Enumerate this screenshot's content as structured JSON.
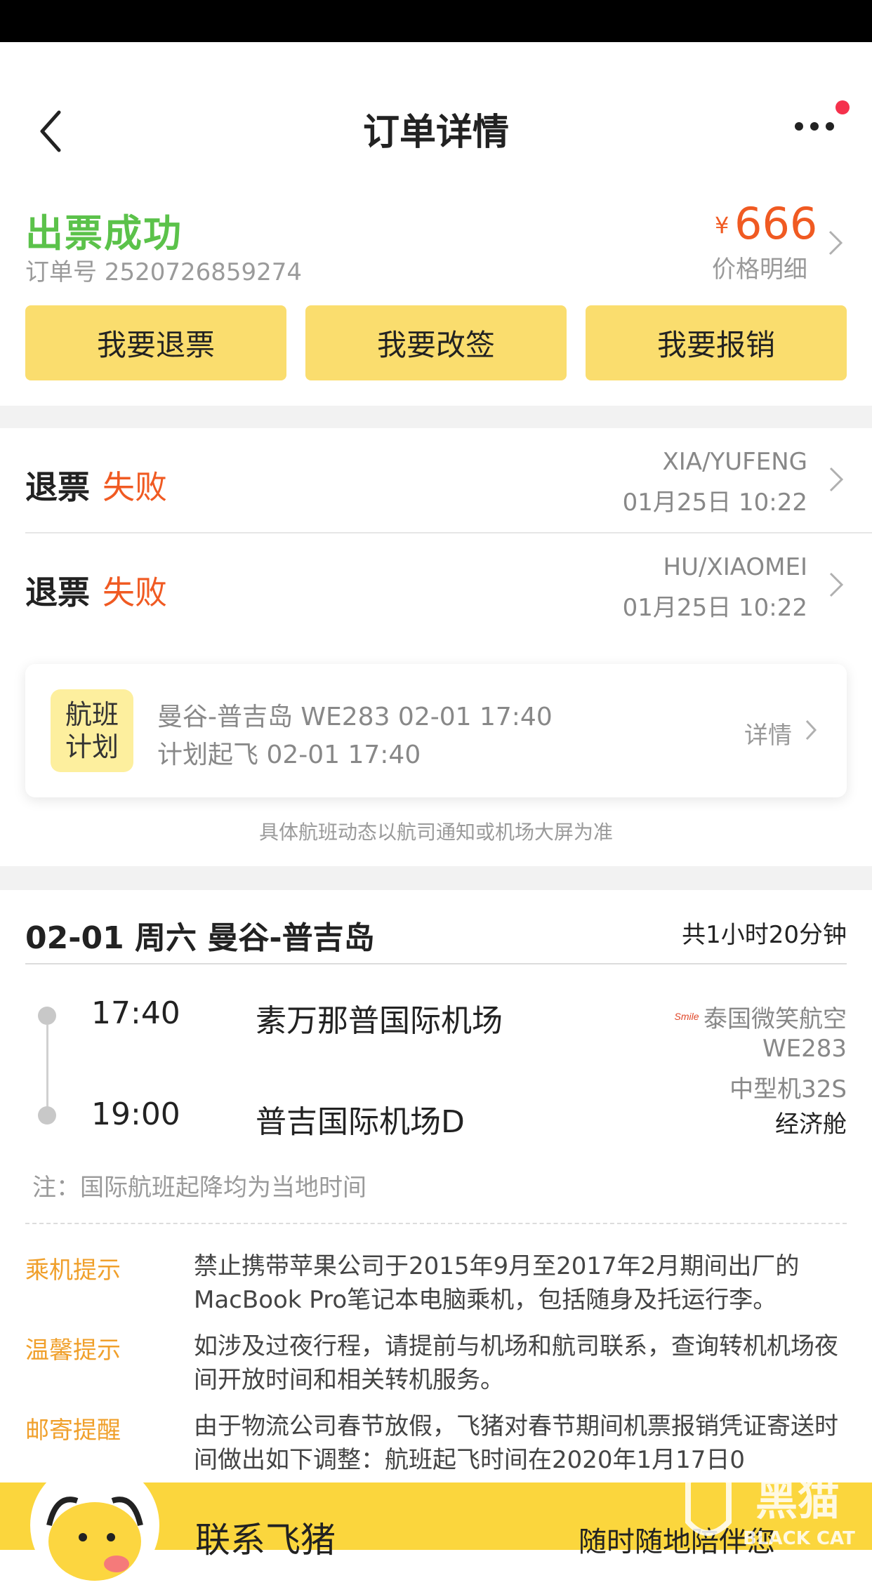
{
  "header": {
    "title": "订单详情"
  },
  "order": {
    "status": "出票成功",
    "order_number": "订单号 2520726859274",
    "currency_symbol": "¥",
    "price": "666",
    "price_detail_label": "价格明细"
  },
  "actions": {
    "refund": "我要退票",
    "change": "我要改签",
    "reimburse": "我要报销"
  },
  "refunds": [
    {
      "label": "退票",
      "status": "失败",
      "passenger": "XIA/YUFENG",
      "time": "01月25日 10:22"
    },
    {
      "label": "退票",
      "status": "失败",
      "passenger": "HU/XIAOMEI",
      "time": "01月25日 10:22"
    }
  ],
  "flight_plan": {
    "badge": "航班计划",
    "route_line": "曼谷-普吉岛 WE283 02-01 17:40",
    "departure_line": "计划起飞 02-01 17:40",
    "detail_label": "详情",
    "note": "具体航班动态以航司通知或机场大屏为准"
  },
  "trip": {
    "header": "02-01 周六 曼谷-普吉岛",
    "duration": "共1小时20分钟",
    "departure_time": "17:40",
    "departure_airport": "素万那普国际机场",
    "arrival_time": "19:00",
    "arrival_airport": "普吉国际机场D",
    "airline": "泰国微笑航空",
    "airline_logo_text": "Smile",
    "flight_number": "WE283",
    "aircraft": "中型机32S",
    "cabin": "经济舱",
    "local_time_note": "注：国际航班起降均为当地时间"
  },
  "tips": [
    {
      "label": "乘机提示",
      "text": "禁止携带苹果公司于2015年9月至2017年2月期间出厂的MacBook Pro笔记本电脑乘机，包括随身及托运行李。"
    },
    {
      "label": "温馨提示",
      "text": "如涉及过夜行程，请提前与机场和航司联系，查询转机机场夜间开放时间和相关转机服务。"
    },
    {
      "label": "邮寄提醒",
      "text": "由于物流公司春节放假，飞猪对春节期间机票报销凭证寄送时间做出如下调整：航班起飞时间在2020年1月17日0"
    }
  ],
  "bottom": {
    "contact_label": "联系飞猪",
    "slogan": "随时随地陪伴您",
    "watermark_text": "黑猫",
    "watermark_sub": "BLACK CAT"
  },
  "colors": {
    "accent_yellow": "#fadd6e",
    "success_green": "#5bc24a",
    "warn_orange": "#f05a22",
    "tip_orange": "#f0a02c"
  },
  "icons": [
    "back-arrow",
    "more-dots",
    "chevron-right",
    "airline-logo",
    "mascot"
  ]
}
